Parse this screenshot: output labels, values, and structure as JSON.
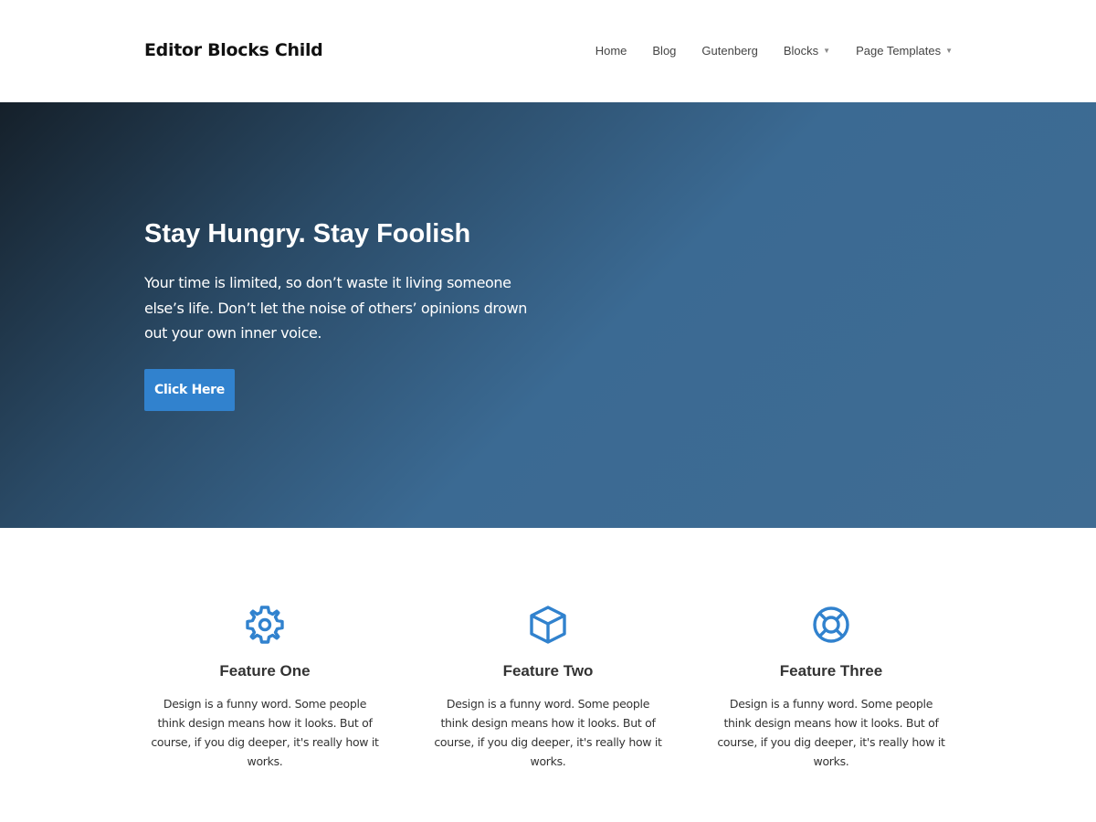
{
  "header": {
    "site_title": "Editor Blocks Child",
    "nav": [
      {
        "label": "Home",
        "has_dropdown": false
      },
      {
        "label": "Blog",
        "has_dropdown": false
      },
      {
        "label": "Gutenberg",
        "has_dropdown": false
      },
      {
        "label": "Blocks",
        "has_dropdown": true
      },
      {
        "label": "Page Templates",
        "has_dropdown": true
      }
    ],
    "caret_glyph": "▼"
  },
  "hero": {
    "title": "Stay Hungry. Stay Foolish",
    "text": "Your time is limited, so don’t waste it living someone else’s life. Don’t let the noise of others’ opinions drown out your own inner voice.",
    "button_label": "Click Here",
    "button_color": "#3182ce",
    "gradient_start": "#15202a",
    "gradient_end": "#3f6c93"
  },
  "features": [
    {
      "icon": "gear-icon",
      "title": "Feature One",
      "text": "Design is a funny word. Some people think design means how it looks. But of course, if you dig deeper, it's really how it works."
    },
    {
      "icon": "cube-icon",
      "title": "Feature Two",
      "text": "Design is a funny word. Some people think design means how it looks. But of course, if you dig deeper, it's really how it works."
    },
    {
      "icon": "lifebuoy-icon",
      "title": "Feature Three",
      "text": "Design is a funny word. Some people think design means how it looks. But of course, if you dig deeper, it's really how it works."
    }
  ],
  "colors": {
    "accent": "#3182ce",
    "text_dark": "#333333"
  }
}
